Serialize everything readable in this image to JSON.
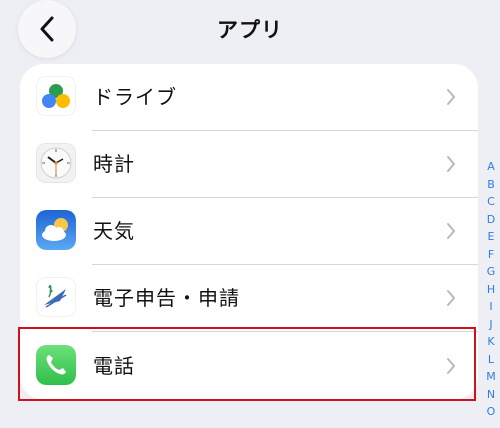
{
  "header": {
    "title": "アプリ"
  },
  "apps": [
    {
      "label": "ドライブ",
      "icon": "google-drive-icon"
    },
    {
      "label": "時計",
      "icon": "clock-icon"
    },
    {
      "label": "天気",
      "icon": "weather-icon"
    },
    {
      "label": "電子申告・申請",
      "icon": "e-tax-icon"
    },
    {
      "label": "電話",
      "icon": "phone-icon"
    }
  ],
  "index_letters": [
    "A",
    "B",
    "C",
    "D",
    "E",
    "F",
    "G",
    "H",
    "I",
    "J",
    "K",
    "L",
    "M",
    "N",
    "O"
  ],
  "colors": {
    "accent": "#2f7de1",
    "highlight": "#d0111b",
    "background": "#eeeff4"
  }
}
